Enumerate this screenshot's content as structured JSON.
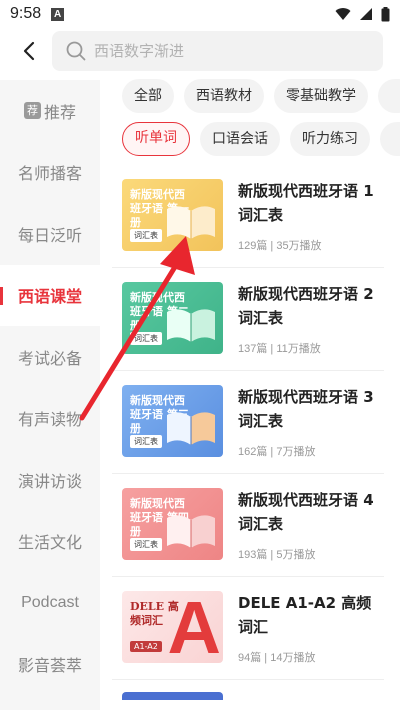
{
  "status": {
    "time": "9:58",
    "notif": "A"
  },
  "search": {
    "placeholder": "西语数字渐进"
  },
  "sidebar": {
    "items": [
      {
        "badge": "荐",
        "label": "推荐"
      },
      {
        "label": "名师播客"
      },
      {
        "label": "每日泛听"
      },
      {
        "label": "西语课堂"
      },
      {
        "label": "考试必备"
      },
      {
        "label": "有声读物"
      },
      {
        "label": "演讲访谈"
      },
      {
        "label": "生活文化"
      },
      {
        "label": "Podcast"
      },
      {
        "label": "影音荟萃"
      }
    ]
  },
  "filters": {
    "row1": [
      "全部",
      "西语教材",
      "零基础教学"
    ],
    "row2": [
      "听单词",
      "口语会话",
      "听力练习"
    ]
  },
  "list": [
    {
      "cover_title": "新版现代西班牙语 第一册",
      "cover_tag": "词汇表",
      "title": "新版现代西班牙语 1 词汇表",
      "meta": "129篇 | 35万播放"
    },
    {
      "cover_title": "新版现代西班牙语 第二册",
      "cover_tag": "词汇表",
      "title": "新版现代西班牙语 2 词汇表",
      "meta": "137篇 | 11万播放"
    },
    {
      "cover_title": "新版现代西班牙语 第三册",
      "cover_tag": "词汇表",
      "title": "新版现代西班牙语 3 词汇表",
      "meta": "162篇 | 7万播放"
    },
    {
      "cover_title": "新版现代西班牙语 第四册",
      "cover_tag": "词汇表",
      "title": "新版现代西班牙语 4 词汇表",
      "meta": "193篇 | 5万播放"
    },
    {
      "cover_title": "DELE 高频词汇",
      "cover_tag": "A1-A2",
      "cover_letter": "A",
      "title": "DELE A1-A2 高频词汇",
      "meta": "94篇 | 14万播放"
    }
  ],
  "colors": {
    "accent": "#e8343c",
    "arrow": "#e8262e"
  }
}
